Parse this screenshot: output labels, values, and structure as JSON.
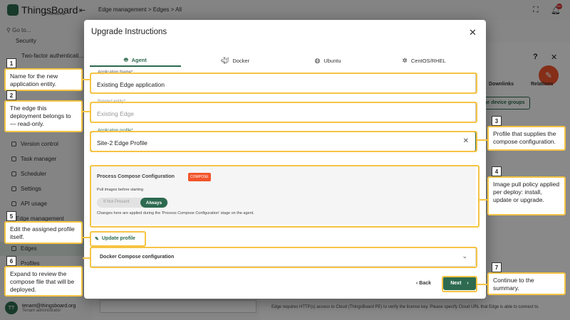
{
  "app": {
    "brand": "ThingsBoard",
    "edition": "Professional",
    "brand_color": "#2d6a4f",
    "accent_color": "#f2552c"
  },
  "sidebar": {
    "goto_placeholder": "Go to...",
    "items": [
      {
        "label": "Security"
      },
      {
        "label": "Two-factor authenticati..."
      },
      {
        "label": "Version control"
      },
      {
        "label": "Task manager"
      },
      {
        "label": "Scheduler"
      },
      {
        "label": "Settings"
      },
      {
        "label": "API usage"
      },
      {
        "label": "Edge management"
      },
      {
        "label": "Edges"
      },
      {
        "label": "Profiles"
      }
    ],
    "user_name": "tenant@thingsboard.org",
    "user_role": "Tenant administrator",
    "user_initials": "TT"
  },
  "topbar": {
    "breadcrumb": "Edge management   >   Edges   >   All",
    "notification_count": "99+"
  },
  "right_panel": {
    "tabs": [
      "Downlinks",
      "Relations"
    ],
    "manage_button": "ge device groups",
    "footer_text": "Edge requires HTTP(s) access to Cloud (ThingsBoard PE) to verify the license key. Please specify Cloud URL that Edge is able to connect to."
  },
  "dialog": {
    "title": "Upgrade Instructions",
    "tabs": [
      {
        "label": "Agent",
        "icon": "agent-icon",
        "active": true
      },
      {
        "label": "Docker",
        "icon": "docker-icon",
        "active": false
      },
      {
        "label": "Ubuntu",
        "icon": "ubuntu-icon",
        "active": false
      },
      {
        "label": "CentOS/RHEL",
        "icon": "centos-icon",
        "active": false
      }
    ],
    "fields": {
      "app_name": {
        "label": "Application Name*",
        "value": "Existing Edge application"
      },
      "related_entity": {
        "label": "Related entity*",
        "value": "Existing Edge"
      },
      "app_profile": {
        "label": "Application profile*",
        "value": "Site-2 Edge Profile"
      }
    },
    "process": {
      "title": "Process Compose Configuration",
      "badge": "COMPOSE",
      "subtitle": "Pull images before starting",
      "option_off": "If Not Present",
      "option_on": "Always",
      "note": "Changes here are applied during the 'Process Compose Configuration' stage on the agent."
    },
    "update_profile": "Update profile",
    "compose_section": "Docker Compose configuration",
    "back": "Back",
    "next": "Next"
  },
  "callouts": [
    {
      "num": "1",
      "text": "Name for the new application entity."
    },
    {
      "num": "2",
      "text": "The edge this deployment belongs to — read-only."
    },
    {
      "num": "3",
      "text": "Profile that supplies the compose configuration."
    },
    {
      "num": "4",
      "text": "Image pull policy applied per deploy: install, update or upgrade."
    },
    {
      "num": "5",
      "text": "Edit the assigned profile itself."
    },
    {
      "num": "6",
      "text": "Expand to review the compose file that will be deployed."
    },
    {
      "num": "7",
      "text": "Continue to the summary."
    }
  ]
}
